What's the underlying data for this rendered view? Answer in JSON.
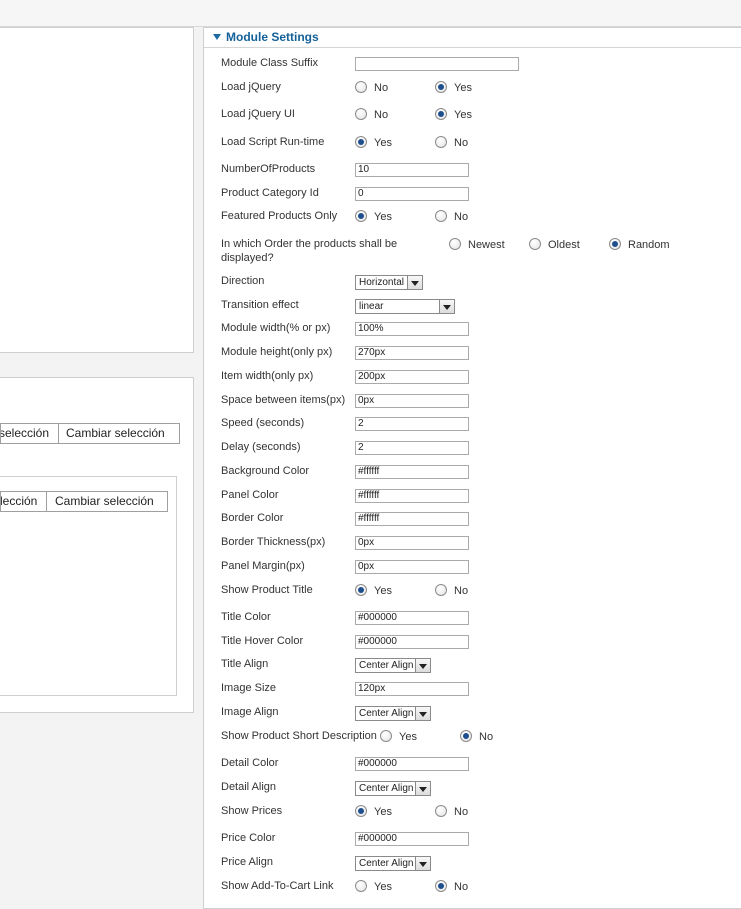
{
  "left": {
    "tabs_top": {
      "item_a": "selección",
      "item_b": "Cambiar selección"
    },
    "tabs_bottom": {
      "item_a": "lección",
      "item_b": "Cambiar selección"
    }
  },
  "module_settings": {
    "title": "Module Settings",
    "fields": {
      "class_suffix": {
        "label": "Module Class Suffix",
        "value": ""
      },
      "load_jquery": {
        "label": "Load jQuery",
        "options": [
          "No",
          "Yes"
        ],
        "selected": "Yes"
      },
      "load_jquery_ui": {
        "label": "Load jQuery UI",
        "options": [
          "No",
          "Yes"
        ],
        "selected": "Yes"
      },
      "load_script": {
        "label": "Load Script Run-time",
        "options": [
          "Yes",
          "No"
        ],
        "selected": "Yes"
      },
      "number_of_products": {
        "label": "NumberOfProducts",
        "value": "10"
      },
      "category_id": {
        "label": "Product Category Id",
        "value": "0"
      },
      "featured_only": {
        "label": "Featured Products Only",
        "options": [
          "Yes",
          "No"
        ],
        "selected": "Yes"
      },
      "order": {
        "label_line1": "In which Order the products shall be",
        "label_line2": "displayed?",
        "options": [
          "Newest",
          "Oldest",
          "Random"
        ],
        "selected": "Random"
      },
      "direction": {
        "label": "Direction",
        "value": "Horizontal"
      },
      "transition": {
        "label": "Transition effect",
        "value": "linear"
      },
      "module_width": {
        "label": "Module width(% or px)",
        "value": "100%"
      },
      "module_height": {
        "label": "Module height(only px)",
        "value": "270px"
      },
      "item_width": {
        "label": "Item width(only px)",
        "value": "200px"
      },
      "space_between": {
        "label": "Space between items(px)",
        "value": "0px"
      },
      "speed": {
        "label": "Speed (seconds)",
        "value": "2"
      },
      "delay": {
        "label": "Delay (seconds)",
        "value": "2"
      },
      "background_color": {
        "label": "Background Color",
        "value": "#ffffff"
      },
      "panel_color": {
        "label": "Panel Color",
        "value": "#ffffff"
      },
      "border_color": {
        "label": "Border Color",
        "value": "#ffffff"
      },
      "border_thickness": {
        "label": "Border Thickness(px)",
        "value": "0px"
      },
      "panel_margin": {
        "label": "Panel Margin(px)",
        "value": "0px"
      },
      "show_title": {
        "label": "Show Product Title",
        "options": [
          "Yes",
          "No"
        ],
        "selected": "Yes"
      },
      "title_color": {
        "label": "Title Color",
        "value": "#000000"
      },
      "title_hover_color": {
        "label": "Title Hover Color",
        "value": "#000000"
      },
      "title_align": {
        "label": "Title Align",
        "value": "Center Align"
      },
      "image_size": {
        "label": "Image Size",
        "value": "120px"
      },
      "image_align": {
        "label": "Image Align",
        "value": "Center Align"
      },
      "short_desc": {
        "label": "Show Product Short Description",
        "options": [
          "Yes",
          "No"
        ],
        "selected": "No"
      },
      "detail_color": {
        "label": "Detail Color",
        "value": "#000000"
      },
      "detail_align": {
        "label": "Detail Align",
        "value": "Center Align"
      },
      "show_prices": {
        "label": "Show Prices",
        "options": [
          "Yes",
          "No"
        ],
        "selected": "Yes"
      },
      "price_color": {
        "label": "Price Color",
        "value": "#000000"
      },
      "price_align": {
        "label": "Price Align",
        "value": "Center Align"
      },
      "add_to_cart": {
        "label": "Show Add-To-Cart Link",
        "options": [
          "Yes",
          "No"
        ],
        "selected": "No"
      }
    }
  }
}
